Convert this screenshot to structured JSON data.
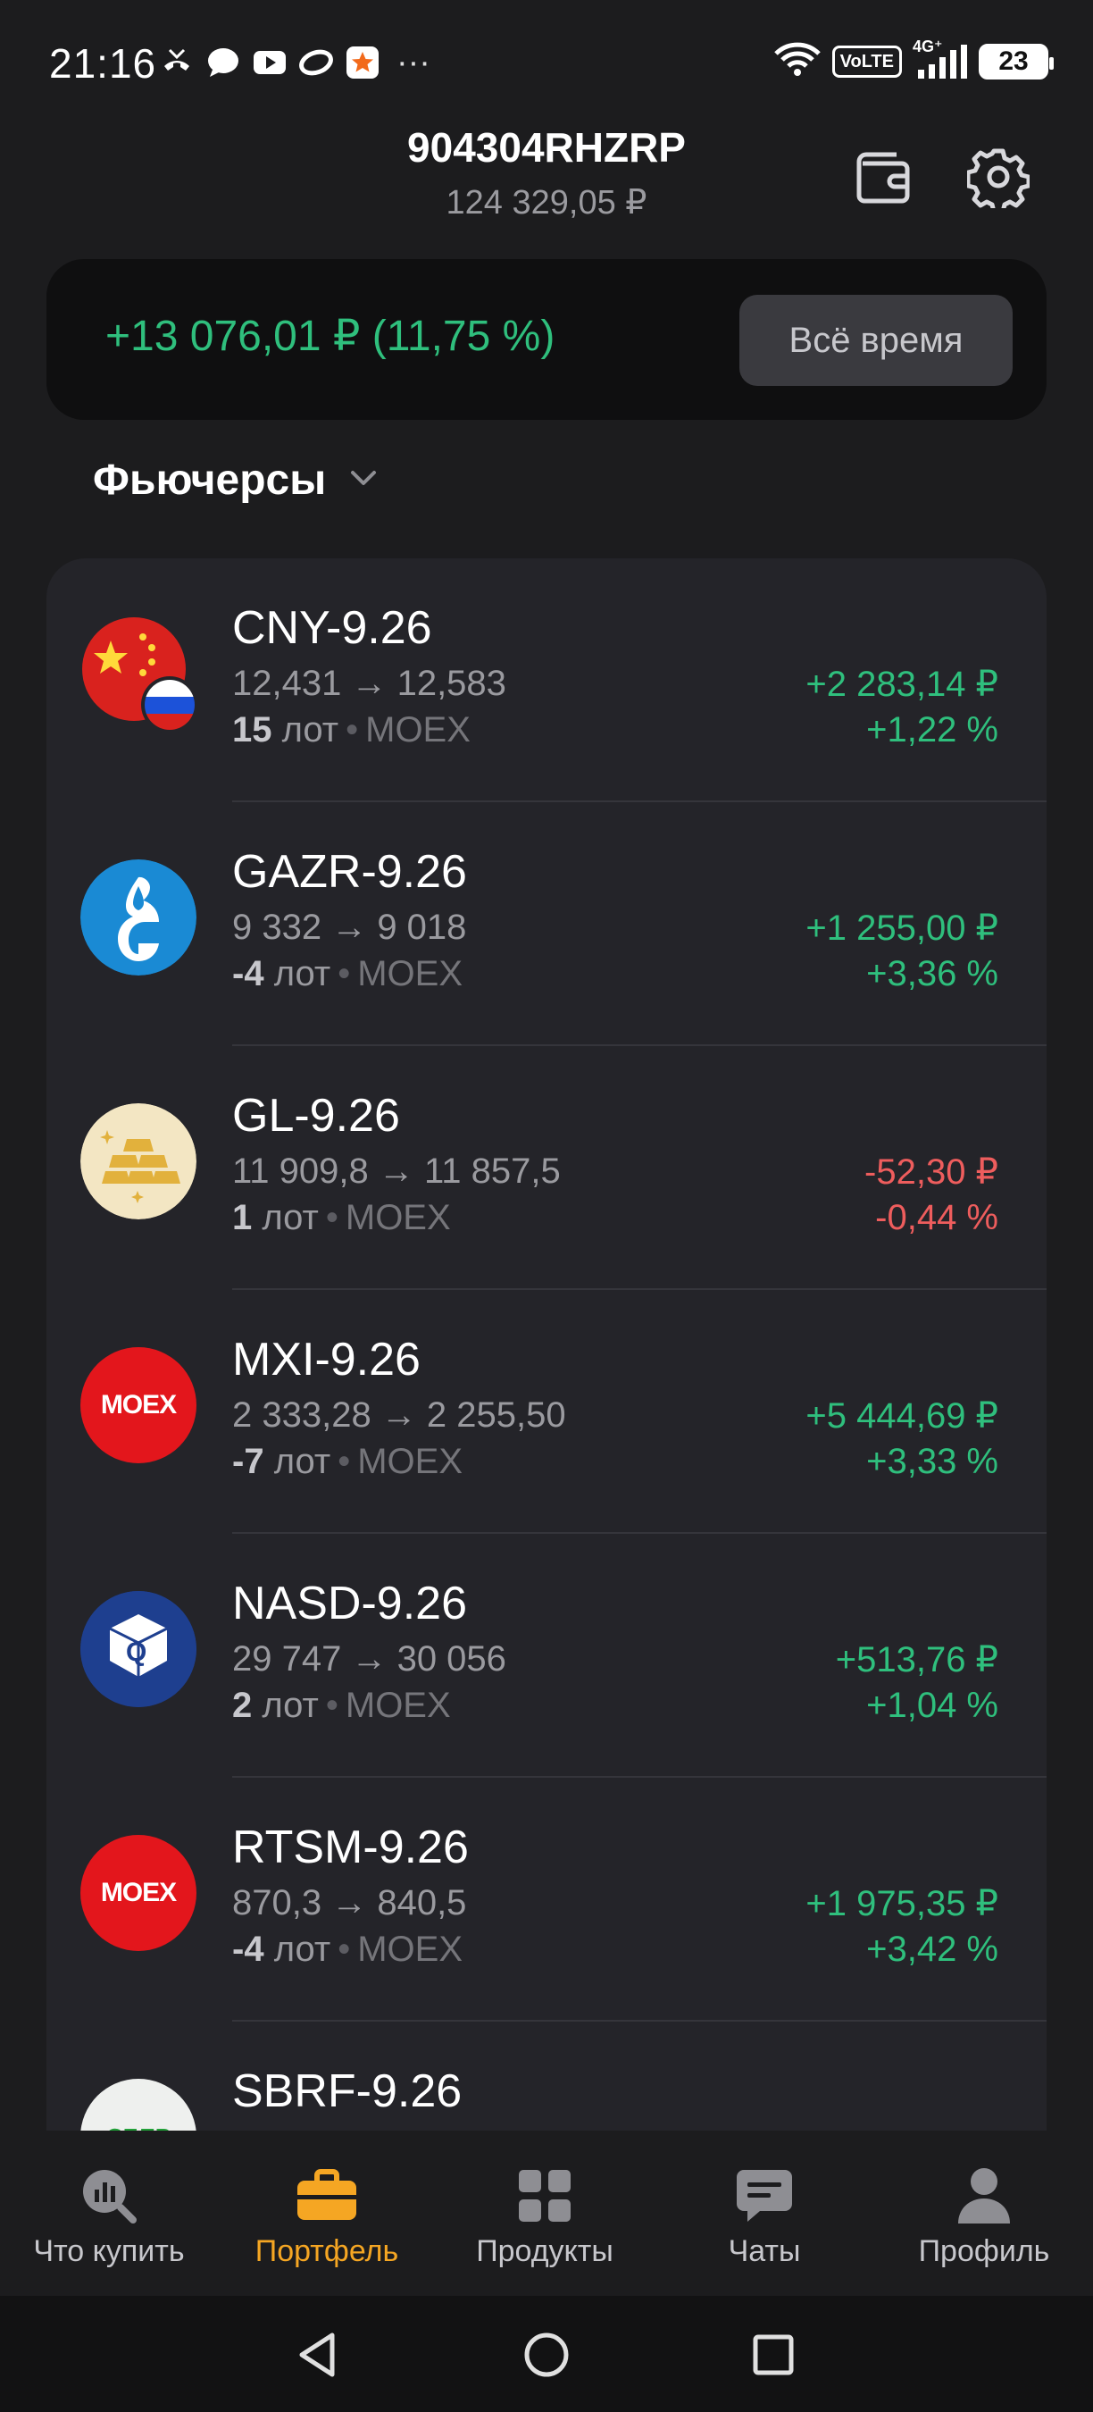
{
  "status_bar": {
    "time": "21:16",
    "more": "···",
    "network": "VoLTE",
    "network_type": "4G⁺",
    "battery": "23"
  },
  "header": {
    "account_id": "904304RHZRP",
    "account_total": "124 329,05 ₽"
  },
  "profit": {
    "value": "+13 076,01 ₽ (11,75 %)",
    "period": "Всё время"
  },
  "section": {
    "title": "Фьючерсы"
  },
  "positions": [
    {
      "ticker": "CNY-9.26",
      "prices": "12,431 → 12,583",
      "qty": "15",
      "lot_word": "лот",
      "exchange": "MOEX",
      "pnl": "+2 283,14 ₽",
      "pct": "+1,22 %",
      "positive": true,
      "logo": "china-russia-flag-icon"
    },
    {
      "ticker": "GAZR-9.26",
      "prices": "9 332 → 9 018",
      "qty": "-4",
      "lot_word": "лот",
      "exchange": "MOEX",
      "pnl": "+1 255,00 ₽",
      "pct": "+3,36 %",
      "positive": true,
      "logo": "gazprom-icon"
    },
    {
      "ticker": "GL-9.26",
      "prices": "11 909,8 → 11 857,5",
      "qty": "1",
      "lot_word": "лот",
      "exchange": "MOEX",
      "pnl": "-52,30 ₽",
      "pct": "-0,44 %",
      "positive": false,
      "logo": "gold-bars-icon"
    },
    {
      "ticker": "MXI-9.26",
      "prices": "2 333,28 → 2 255,50",
      "qty": "-7",
      "lot_word": "лот",
      "exchange": "MOEX",
      "pnl": "+5 444,69 ₽",
      "pct": "+3,33 %",
      "positive": true,
      "logo": "moex-icon"
    },
    {
      "ticker": "NASD-9.26",
      "prices": "29 747 → 30 056",
      "qty": "2",
      "lot_word": "лот",
      "exchange": "MOEX",
      "pnl": "+513,76 ₽",
      "pct": "+1,04 %",
      "positive": true,
      "logo": "nasdaq-cube-icon"
    },
    {
      "ticker": "RTSM-9.26",
      "prices": "870,3 → 840,5",
      "qty": "-4",
      "lot_word": "лот",
      "exchange": "MOEX",
      "pnl": "+1 975,35 ₽",
      "pct": "+3,42 %",
      "positive": true,
      "logo": "moex-icon"
    },
    {
      "ticker": "SBRF-9.26",
      "logo": "sber-icon"
    }
  ],
  "logo_text": {
    "moex": "MOEX",
    "nasdaq": "Q",
    "sber": "СБЕР"
  },
  "tabs": [
    {
      "label": "Что купить",
      "icon": "chart-search-icon",
      "active": false
    },
    {
      "label": "Портфель",
      "icon": "briefcase-icon",
      "active": true
    },
    {
      "label": "Продукты",
      "icon": "grid-icon",
      "active": false
    },
    {
      "label": "Чаты",
      "icon": "chat-icon",
      "active": false
    },
    {
      "label": "Профиль",
      "icon": "person-icon",
      "active": false
    }
  ],
  "colors": {
    "positive": "#2fbf7d",
    "negative": "#ee5d5d",
    "accent": "#f5a623",
    "background": "#1c1c1e",
    "card": "#242429"
  }
}
